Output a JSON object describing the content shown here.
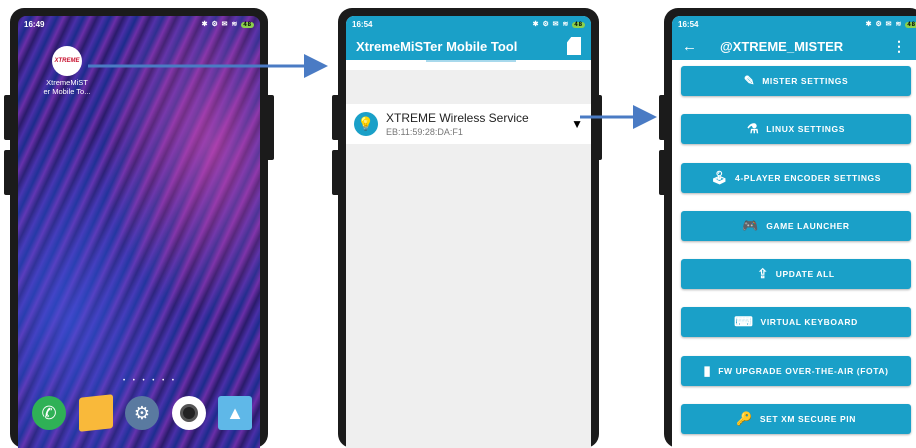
{
  "phone1": {
    "status_time": "16:49",
    "status_icons": "✱ ⚙ ✉ ≋ ",
    "battery": "48",
    "app_logo_text": "XTREME",
    "app_label": "XtremeMiST er Mobile To...",
    "page_dots": "• • • • • •",
    "dock": [
      "phone-icon",
      "notes-icon",
      "settings-icon",
      "camera-icon",
      "gallery-icon"
    ]
  },
  "phone2": {
    "status_time": "16:54",
    "status_icons": "✱ ⚙ ✉ ≋ ",
    "battery": "48",
    "title": "XtremeMiSTer Mobile Tool",
    "device_name": "XTREME Wireless Service",
    "device_mac": "EB:11:59:28:DA:F1"
  },
  "phone3": {
    "status_time": "16:54",
    "status_icons": "✱ ⚙ ✉ ≋ ",
    "battery": "48",
    "title": "@XTREME_MISTER",
    "buttons": [
      {
        "label": "MISTER SETTINGS",
        "icon": "edit-icon"
      },
      {
        "label": "LINUX SETTINGS",
        "icon": "flask-icon"
      },
      {
        "label": "4-PLAYER ENCODER SETTINGS",
        "icon": "joystick-icon"
      },
      {
        "label": "GAME LAUNCHER",
        "icon": "gamepad-icon"
      },
      {
        "label": "UPDATE ALL",
        "icon": "upload-icon"
      },
      {
        "label": "VIRTUAL KEYBOARD",
        "icon": "keyboard-icon"
      },
      {
        "label": "FW UPGRADE OVER-THE-AIR (FOTA)",
        "icon": "file-icon"
      },
      {
        "label": "SET XM SECURE PIN",
        "icon": "key-icon"
      }
    ]
  },
  "colors": {
    "accent": "#1aa0c8",
    "arrow": "#4a7bc4"
  }
}
